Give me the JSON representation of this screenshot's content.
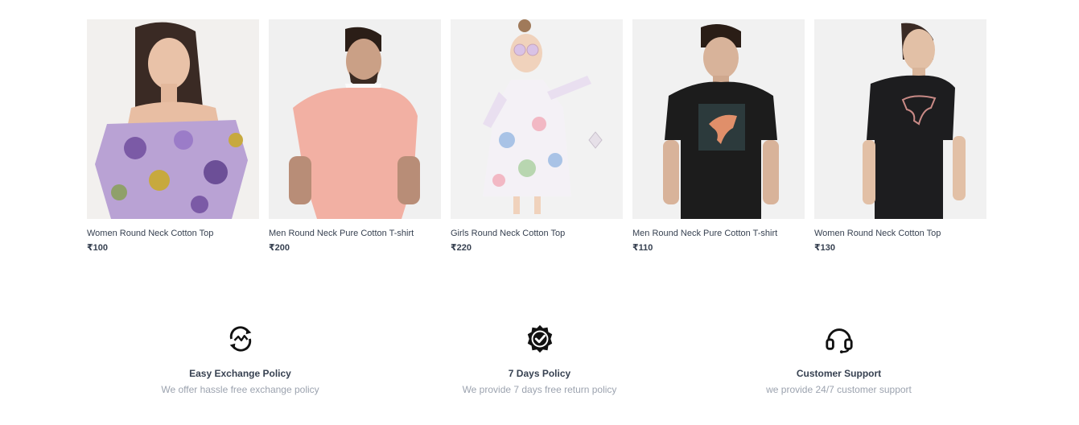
{
  "products": [
    {
      "name": "Women Round Neck Cotton Top",
      "price": "₹100"
    },
    {
      "name": "Men Round Neck Pure Cotton T-shirt",
      "price": "₹200"
    },
    {
      "name": "Girls Round Neck Cotton Top",
      "price": "₹220"
    },
    {
      "name": "Men Round Neck Pure Cotton T-shirt",
      "price": "₹110"
    },
    {
      "name": "Women Round Neck Cotton Top",
      "price": "₹130"
    }
  ],
  "policies": [
    {
      "icon": "exchange-icon",
      "title": "Easy Exchange Policy",
      "desc": "We offer hassle free exchange policy"
    },
    {
      "icon": "quality-badge-icon",
      "title": "7 Days Policy",
      "desc": "We provide 7 days free return policy"
    },
    {
      "icon": "headset-icon",
      "title": "Customer Support",
      "desc": "we provide 24/7 customer support"
    }
  ]
}
